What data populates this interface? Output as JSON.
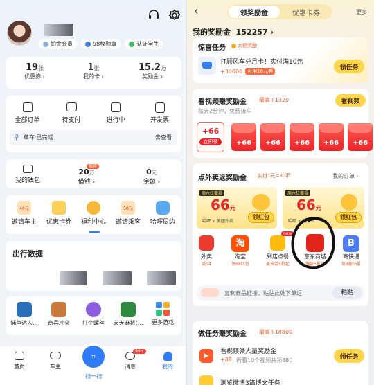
{
  "left": {
    "profile": {
      "badges": [
        "铂金会员",
        "98枚勋章",
        "认证学生"
      ]
    },
    "stats": [
      {
        "value": "19",
        "unit": "张",
        "label": "优惠券"
      },
      {
        "value": "1",
        "unit": "张",
        "label": "我的卡"
      },
      {
        "value": "15.2",
        "unit": "万",
        "label": "奖励金"
      }
    ],
    "orders": [
      {
        "label": "全部订单",
        "icon": "order-list-icon"
      },
      {
        "label": "待支付",
        "icon": "wallet-pay-icon"
      },
      {
        "label": "进行中",
        "icon": "in-progress-icon"
      },
      {
        "label": "开发票",
        "icon": "invoice-icon"
      }
    ],
    "bike_status": "单车·已完成",
    "bike_action": "去查看",
    "wallet": {
      "label": "我的钱包",
      "loan_value": "20",
      "loan_unit": "万",
      "loan_label": "借钱",
      "loan_badge": "推荐",
      "balance_value": "0",
      "balance_unit": "元",
      "balance_label": "余额"
    },
    "services": [
      {
        "label": "邀请车主",
        "badge": "40元"
      },
      {
        "label": "优惠卡券"
      },
      {
        "label": "福利中心"
      },
      {
        "label": "邀请乘客",
        "badge": "50元"
      },
      {
        "label": "哈啰周边"
      }
    ],
    "trip_title": "出行数据",
    "games": [
      "捕鱼达人...",
      "奇兵冲突",
      "打个螺丝",
      "天天麻将(...",
      "更多游戏"
    ],
    "tabs": [
      {
        "label": "首页"
      },
      {
        "label": "车主"
      },
      {
        "label": "扫一扫"
      },
      {
        "label": "消息",
        "badge": "99+"
      },
      {
        "label": "我的"
      }
    ]
  },
  "right": {
    "tabs": [
      "领奖励金",
      "优惠卡券"
    ],
    "more": "更多",
    "reward_title": "我的奖励金",
    "reward_amount": "152257",
    "surprise": {
      "title": "惊喜任务",
      "tag": "大额奖励",
      "task": "打顾风车兑月卡！实付满10元",
      "points": "+30000",
      "tag2": "可用16元券",
      "button": "领任务"
    },
    "video": {
      "title": "看视频赚奖励金",
      "max": "最高+1320",
      "desc": "每天2分钟，免费骑车",
      "button": "看视频",
      "envelopes": [
        "+66",
        "+66",
        "+66",
        "+66",
        "+66",
        "+66",
        "+66"
      ],
      "first_btn": "立即领"
    },
    "takeout": {
      "title": "点外卖返奖励金",
      "tag": "实付1元=30币",
      "link": "我的订单",
      "promos": [
        {
          "top": "周六狂撒福",
          "amount": "66",
          "unit": "元",
          "sub": "哈啰 × 美团外卖",
          "btn": "领红包"
        },
        {
          "top": "周六狂撒福",
          "amount": "66",
          "unit": "元",
          "sub": "哈啰 × 饿了么",
          "btn": "领红包"
        }
      ],
      "apps": [
        {
          "label": "外卖",
          "sub": "减14"
        },
        {
          "label": "淘宝",
          "sub": "领66红包"
        },
        {
          "label": "到店点餐",
          "sub": "麦当劳5折起",
          "badge": "new"
        },
        {
          "label": "京东商城",
          "sub": "爆款5折起"
        },
        {
          "label": "寄快递",
          "sub": "官网价6折"
        }
      ],
      "paste_text": "复制商品链接，粘贴此处下单返",
      "paste_btn": "粘贴"
    },
    "tasks": {
      "title": "做任务赚奖励金",
      "max": "最高+18800",
      "items": [
        {
          "label": "看视频领大量奖励金",
          "points": "+88",
          "desc": "再看10个视频共领880",
          "button": "领任务"
        },
        {
          "label": "浏览微博3篇博文任务"
        }
      ]
    }
  }
}
